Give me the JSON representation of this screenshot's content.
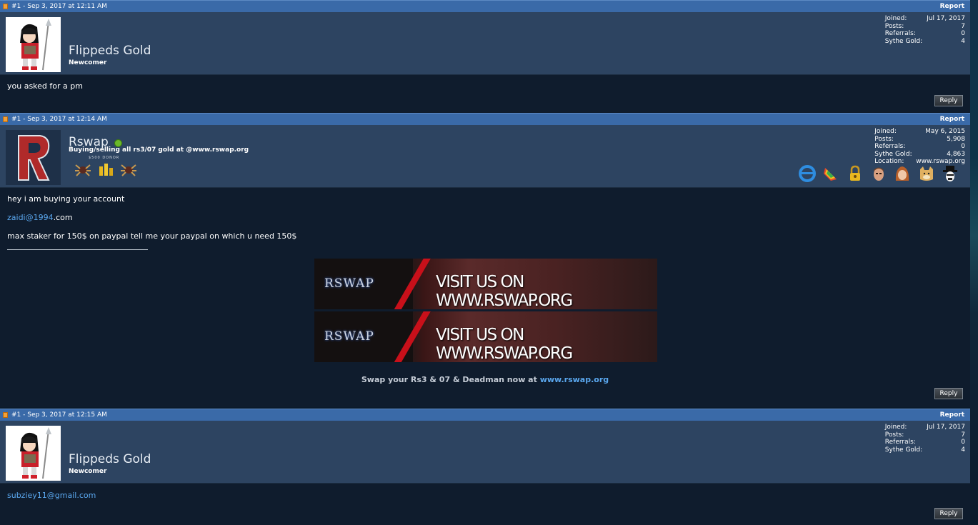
{
  "posts": [
    {
      "meta": "#1 - Sep 3, 2017 at 12:11 AM",
      "report": "Report",
      "username": "Flippeds Gold",
      "usertitle": "Newcomer",
      "stats": [
        {
          "label": "Joined:",
          "value": "Jul 17, 2017"
        },
        {
          "label": "Posts:",
          "value": "7"
        },
        {
          "label": "Referrals:",
          "value": "0"
        },
        {
          "label": "Sythe Gold:",
          "value": "4"
        }
      ],
      "message": "you asked for a pm",
      "reply": "Reply"
    },
    {
      "meta": "#1 - Sep 3, 2017 at 12:14 AM",
      "report": "Report",
      "username": "Rswap",
      "usertitle": "Buying/selling all rs3/07 gold at @www.rswap.org",
      "donor_label": "$500 DONOR",
      "stats": [
        {
          "label": "Joined:",
          "value": "May 6, 2015"
        },
        {
          "label": "Posts:",
          "value": "5,908"
        },
        {
          "label": "Referrals:",
          "value": "0"
        },
        {
          "label": "Sythe Gold:",
          "value": "4,863"
        },
        {
          "label": "Location:",
          "value": "www.rswap.org"
        }
      ],
      "trophy_icons": [
        "ie-icon",
        "rainbow-icon",
        "padlock-icon",
        "face-icon",
        "hair-icon",
        "doge-icon",
        "heisenberg-icon"
      ],
      "lines": [
        "hey i am buying your account",
        "max staker for 150$ on paypal tell me your paypal on which u need 150$"
      ],
      "email_link": "zaidi@1994",
      "email_suffix": ".com",
      "banner_logo": "RSWAP",
      "banner_text": "VISIT US ON WWW.RSWAP.ORG",
      "swap_text": "Swap your Rs3 & 07 & Deadman now at ",
      "swap_link": "www.rswap.org",
      "reply": "Reply"
    },
    {
      "meta": "#1 - Sep 3, 2017 at 12:15 AM",
      "report": "Report",
      "username": "Flippeds Gold",
      "usertitle": "Newcomer",
      "stats": [
        {
          "label": "Joined:",
          "value": "Jul 17, 2017"
        },
        {
          "label": "Posts:",
          "value": "7"
        },
        {
          "label": "Referrals:",
          "value": "0"
        },
        {
          "label": "Sythe Gold:",
          "value": "4"
        }
      ],
      "message": "subziey11@gmail.com",
      "reply": "Reply"
    }
  ]
}
